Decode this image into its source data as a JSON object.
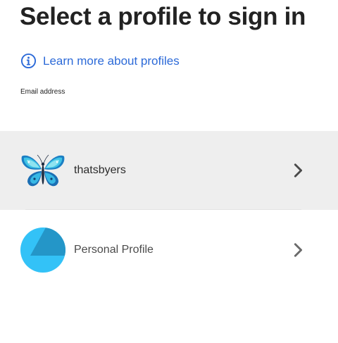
{
  "header": {
    "title": "Select a profile to sign in"
  },
  "learn_more": {
    "icon": "info-circle-icon",
    "label": "Learn more about profiles",
    "color": "#2c6ad8"
  },
  "email_label": "Email address",
  "profiles": [
    {
      "name": "thatsbyers",
      "avatar": "butterfly-avatar",
      "selected": true,
      "chevron": "chevron-right-icon"
    },
    {
      "name": "Personal Profile",
      "avatar": "personal-profile-avatar",
      "selected": false,
      "chevron": "chevron-right-icon"
    }
  ],
  "colors": {
    "selected_row_bg": "#eeeeee",
    "avatar_blue": "#33c2f7",
    "avatar_blue_dark": "#2496c8"
  }
}
